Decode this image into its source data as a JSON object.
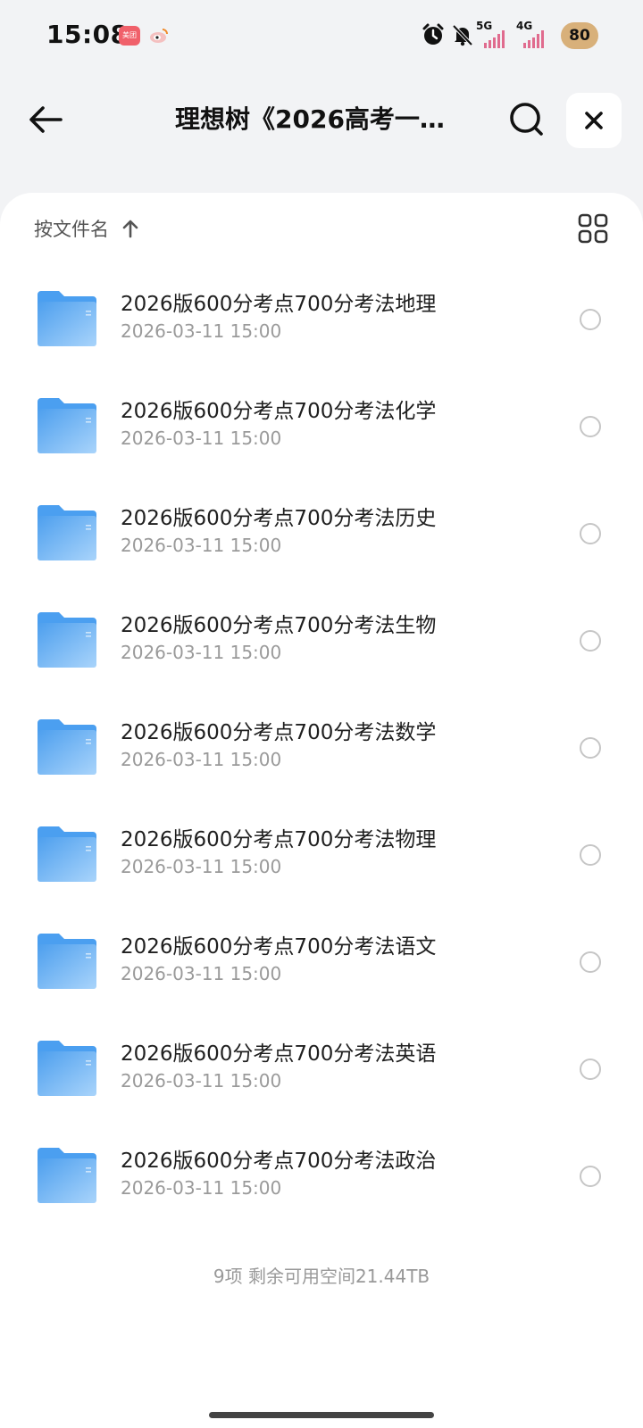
{
  "status_bar": {
    "time": "15:08",
    "app_icon_text": "美团",
    "network_1": "5G",
    "network_2": "4G",
    "battery": "80"
  },
  "header": {
    "title": "理想树《2026高考一…"
  },
  "sort": {
    "label": "按文件名"
  },
  "files": [
    {
      "name": "2026版600分考点700分考法地理",
      "date": "2026-03-11 15:00"
    },
    {
      "name": "2026版600分考点700分考法化学",
      "date": "2026-03-11 15:00"
    },
    {
      "name": "2026版600分考点700分考法历史",
      "date": "2026-03-11 15:00"
    },
    {
      "name": "2026版600分考点700分考法生物",
      "date": "2026-03-11 15:00"
    },
    {
      "name": "2026版600分考点700分考法数学",
      "date": "2026-03-11 15:00"
    },
    {
      "name": "2026版600分考点700分考法物理",
      "date": "2026-03-11 15:00"
    },
    {
      "name": "2026版600分考点700分考法语文",
      "date": "2026-03-11 15:00"
    },
    {
      "name": "2026版600分考点700分考法英语",
      "date": "2026-03-11 15:00"
    },
    {
      "name": "2026版600分考点700分考法政治",
      "date": "2026-03-11 15:00"
    }
  ],
  "footer": {
    "summary": "9项 剩余可用空间21.44TB"
  },
  "icons": {
    "folder_color": "#5aaaf0",
    "accent": "#111111"
  }
}
